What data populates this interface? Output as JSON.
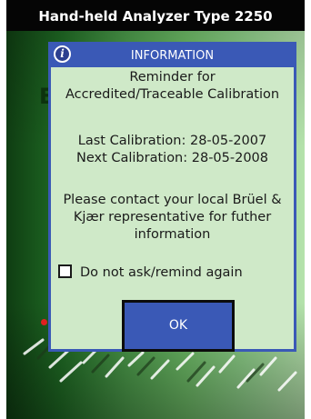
{
  "window": {
    "title": "Hand-held Analyzer Type 2250"
  },
  "background": {
    "partial_letter": "E"
  },
  "dialog": {
    "icon": "info-icon",
    "title": "INFORMATION",
    "lines": [
      "Reminder for",
      "Accredited/Traceable Calibration",
      "Last Calibration: 28-05-2007",
      "Next Calibration: 28-05-2008",
      "Please contact your local Brüel &",
      "Kjær representative for futher",
      "information"
    ],
    "checkbox": {
      "label": "Do not ask/remind again",
      "checked": false
    },
    "ok_label": "OK"
  },
  "colors": {
    "accent": "#3a59b6",
    "dialog_bg": "#cfe9c8",
    "title_bar_bg": "#050505",
    "indicator": "#e02020"
  }
}
